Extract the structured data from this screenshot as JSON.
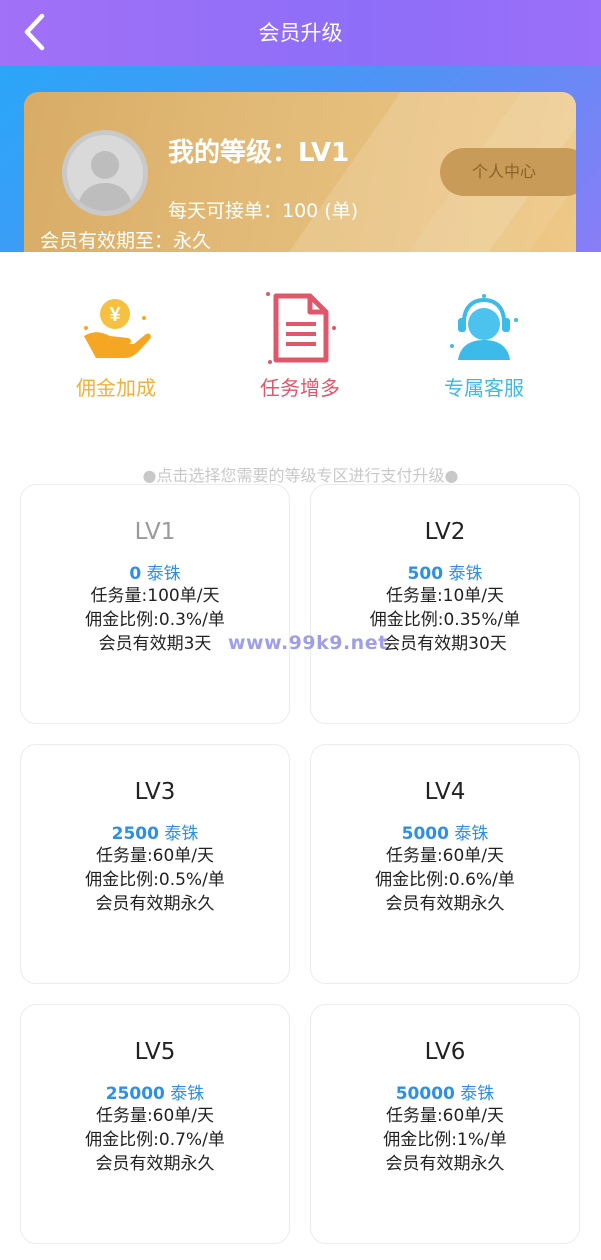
{
  "header": {
    "title": "会员升级"
  },
  "member_card": {
    "level_title": "我的等级：LV1",
    "daily_orders": "每天可接单：100 (单)",
    "expiry": "会员有效期至：永久",
    "center_button": "个人中心"
  },
  "features": [
    {
      "label": "佣金加成",
      "icon": "coin-hand-icon",
      "color": "#f0b13a"
    },
    {
      "label": "任务增多",
      "icon": "document-icon",
      "color": "#e0566b"
    },
    {
      "label": "专属客服",
      "icon": "customer-service-icon",
      "color": "#3dbbe8"
    }
  ],
  "hint": "●点击选择您需要的等级专区进行支付升级●",
  "watermark": "www.99k9.net",
  "currency": "泰铢",
  "tiers": [
    {
      "name": "LV1",
      "price": "0",
      "tasks": "任务量:100单/天",
      "commission": "佣金比例:0.3%/单",
      "validity": "会员有效期3天"
    },
    {
      "name": "LV2",
      "price": "500",
      "tasks": "任务量:10单/天",
      "commission": "佣金比例:0.35%/单",
      "validity": "会员有效期30天"
    },
    {
      "name": "LV3",
      "price": "2500",
      "tasks": "任务量:60单/天",
      "commission": "佣金比例:0.5%/单",
      "validity": "会员有效期永久"
    },
    {
      "name": "LV4",
      "price": "5000",
      "tasks": "任务量:60单/天",
      "commission": "佣金比例:0.6%/单",
      "validity": "会员有效期永久"
    },
    {
      "name": "LV5",
      "price": "25000",
      "tasks": "任务量:60单/天",
      "commission": "佣金比例:0.7%/单",
      "validity": "会员有效期永久"
    },
    {
      "name": "LV6",
      "price": "50000",
      "tasks": "任务量:60单/天",
      "commission": "佣金比例:1%/单",
      "validity": "会员有效期永久"
    }
  ],
  "colors": {
    "header": "#9370f8",
    "card_gold": "#e3bb78",
    "price_blue": "#2f8fe0"
  }
}
